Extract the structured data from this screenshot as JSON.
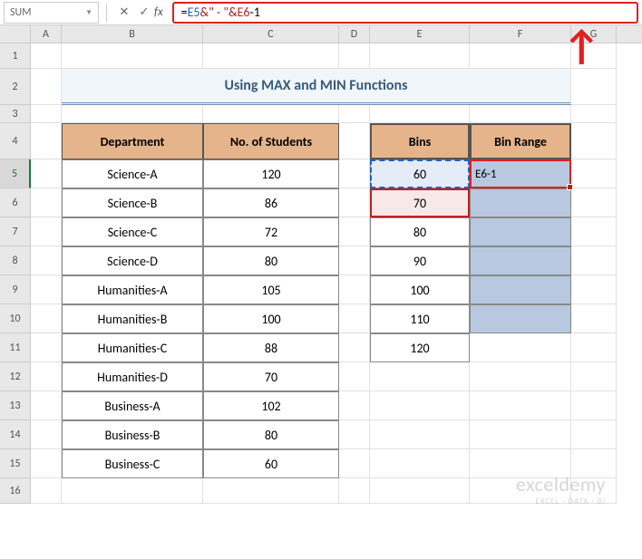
{
  "name_box": "SUM",
  "formula": {
    "eq": "=",
    "ref1": "E5",
    "amp1": " & ",
    "txt": "\" - \"",
    "amp2": " & ",
    "ref2": "E6",
    "minus": "-",
    "num": "1",
    "full": "=E5 & \" - \" & E6-1"
  },
  "columns": [
    "",
    "A",
    "B",
    "C",
    "D",
    "E",
    "F",
    "G"
  ],
  "rows": [
    "1",
    "2",
    "3",
    "4",
    "5",
    "6",
    "7",
    "8",
    "9",
    "10",
    "11",
    "12",
    "13",
    "14",
    "15",
    "16"
  ],
  "title": "Using MAX and MIN Functions",
  "dept_header": "Department",
  "students_header": "No. of Students",
  "bins_header": "Bins",
  "binrange_header": "Bin Range",
  "dept_data": [
    {
      "name": "Science-A",
      "students": "120"
    },
    {
      "name": "Science-B",
      "students": "86"
    },
    {
      "name": "Science-C",
      "students": "72"
    },
    {
      "name": "Science-D",
      "students": "80"
    },
    {
      "name": "Humanities-A",
      "students": "105"
    },
    {
      "name": "Humanities-B",
      "students": "100"
    },
    {
      "name": "Humanities-C",
      "students": "88"
    },
    {
      "name": "Humanities-D",
      "students": "70"
    },
    {
      "name": "Business-A",
      "students": "102"
    },
    {
      "name": "Business-B",
      "students": "80"
    },
    {
      "name": "Business-C",
      "students": "60"
    }
  ],
  "bins_data": [
    "60",
    "70",
    "80",
    "90",
    "100",
    "110",
    "120"
  ],
  "editing_cell_display": "E6-1",
  "watermark": {
    "main": "exceldemy",
    "sub": "EXCEL · DATA · BI"
  },
  "chart_data": {
    "type": "table",
    "title": "Using MAX and MIN Functions",
    "tables": [
      {
        "columns": [
          "Department",
          "No. of Students"
        ],
        "rows": [
          [
            "Science-A",
            120
          ],
          [
            "Science-B",
            86
          ],
          [
            "Science-C",
            72
          ],
          [
            "Science-D",
            80
          ],
          [
            "Humanities-A",
            105
          ],
          [
            "Humanities-B",
            100
          ],
          [
            "Humanities-C",
            88
          ],
          [
            "Humanities-D",
            70
          ],
          [
            "Business-A",
            102
          ],
          [
            "Business-B",
            80
          ],
          [
            "Business-C",
            60
          ]
        ]
      },
      {
        "columns": [
          "Bins",
          "Bin Range"
        ],
        "rows": [
          [
            60,
            "=E5 & \" - \" & E6-1"
          ],
          [
            70,
            ""
          ],
          [
            80,
            ""
          ],
          [
            90,
            ""
          ],
          [
            100,
            ""
          ],
          [
            110,
            ""
          ],
          [
            120,
            ""
          ]
        ]
      }
    ]
  }
}
